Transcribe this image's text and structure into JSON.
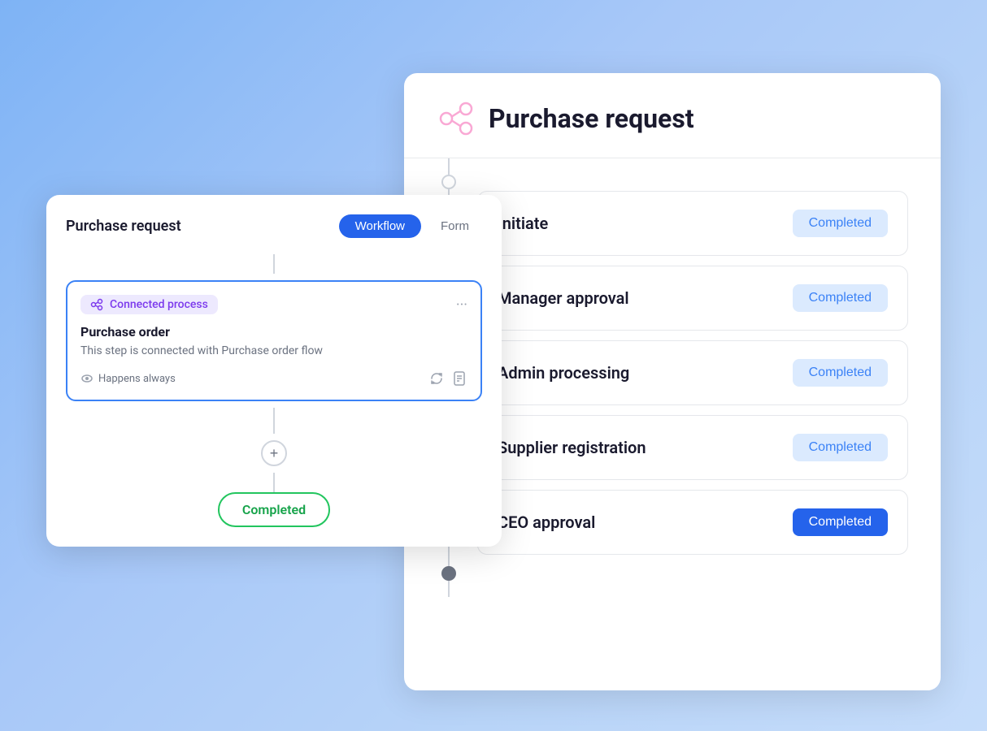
{
  "rightPanel": {
    "title": "Purchase request",
    "workflowIconAlt": "workflow-icon",
    "timelineItems": [
      {
        "label": "Initiate",
        "badge": "Completed",
        "badgeType": "light"
      },
      {
        "label": "Manager approval",
        "badge": "Completed",
        "badgeType": "light"
      },
      {
        "label": "Admin processing",
        "badge": "Completed",
        "badgeType": "light"
      },
      {
        "label": "Supplier registration",
        "badge": "Completed",
        "badgeType": "light"
      },
      {
        "label": "CEO approval",
        "badge": "Completed",
        "badgeType": "primary"
      }
    ]
  },
  "leftPanel": {
    "title": "Purchase request",
    "tabs": {
      "workflow": "Workflow",
      "form": "Form"
    },
    "card": {
      "badgeText": "Connected process",
      "cardTitle": "Purchase order",
      "cardDescription": "This step is connected with Purchase order flow",
      "happensAlways": "Happens always"
    },
    "completedPill": "Completed"
  }
}
